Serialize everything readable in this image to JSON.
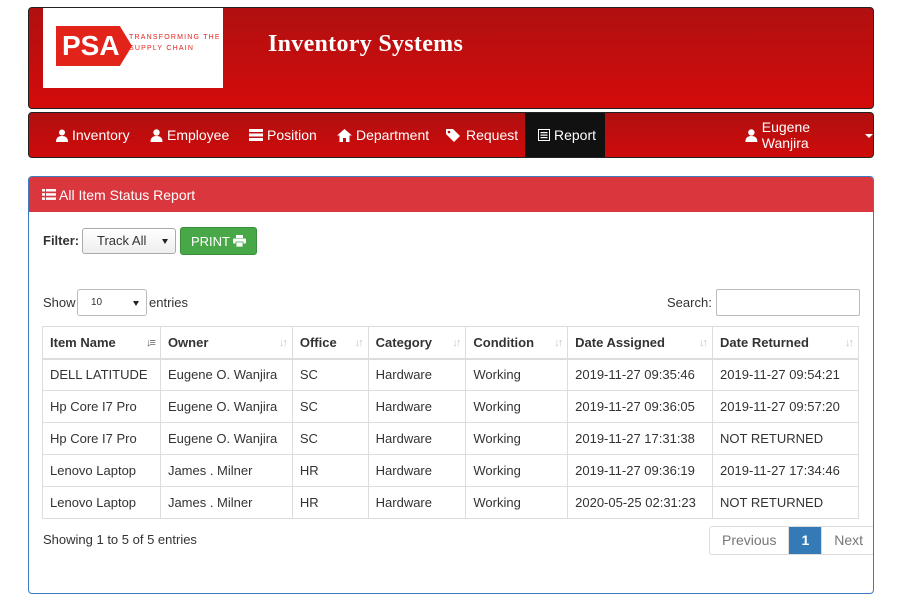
{
  "brand": {
    "logo_text": "PSA",
    "logo_tagline": "TRANSFORMING THE SUPPLY CHAIN",
    "app_title": "Inventory Systems",
    "colors": {
      "header": "#cc0000",
      "panel_heading": "#d9363e",
      "print": "#48a848",
      "pager_active": "#337ab7"
    }
  },
  "nav": {
    "items": [
      {
        "label": "Inventory",
        "icon": "user-icon"
      },
      {
        "label": "Employee",
        "icon": "user-icon"
      },
      {
        "label": "Position",
        "icon": "server-icon"
      },
      {
        "label": "Department",
        "icon": "home-icon"
      },
      {
        "label": "Request",
        "icon": "tags-icon"
      },
      {
        "label": "Report",
        "icon": "list-alt-icon",
        "active": true
      }
    ],
    "user": {
      "label": "Eugene Wanjira",
      "icon": "user-icon"
    }
  },
  "panel": {
    "title": "All Item Status Report",
    "filter_label": "Filter:",
    "filter_value": "Track All",
    "print_label": "PRINT"
  },
  "datatable": {
    "show_label": "Show",
    "page_length": "10",
    "entries_label": "entries",
    "search_label": "Search:",
    "search_value": "",
    "columns": [
      "Item Name",
      "Owner",
      "Office",
      "Category",
      "Condition",
      "Date Assigned",
      "Date Returned"
    ],
    "rows": [
      [
        "DELL LATITUDE",
        "Eugene O. Wanjira",
        "SC",
        "Hardware",
        "Working",
        "2019-11-27 09:35:46",
        "2019-11-27 09:54:21"
      ],
      [
        "Hp Core I7 Pro",
        "Eugene O. Wanjira",
        "SC",
        "Hardware",
        "Working",
        "2019-11-27 09:36:05",
        "2019-11-27 09:57:20"
      ],
      [
        "Hp Core I7 Pro",
        "Eugene O. Wanjira",
        "SC",
        "Hardware",
        "Working",
        "2019-11-27 17:31:38",
        "NOT RETURNED"
      ],
      [
        "Lenovo Laptop",
        "James . Milner",
        "HR",
        "Hardware",
        "Working",
        "2019-11-27 09:36:19",
        "2019-11-27 17:34:46"
      ],
      [
        "Lenovo Laptop",
        "James . Milner",
        "HR",
        "Hardware",
        "Working",
        "2020-05-25 02:31:23",
        "NOT RETURNED"
      ]
    ],
    "info": "Showing 1 to 5 of 5 entries",
    "pagination": {
      "previous": "Previous",
      "current": "1",
      "next": "Next"
    }
  }
}
